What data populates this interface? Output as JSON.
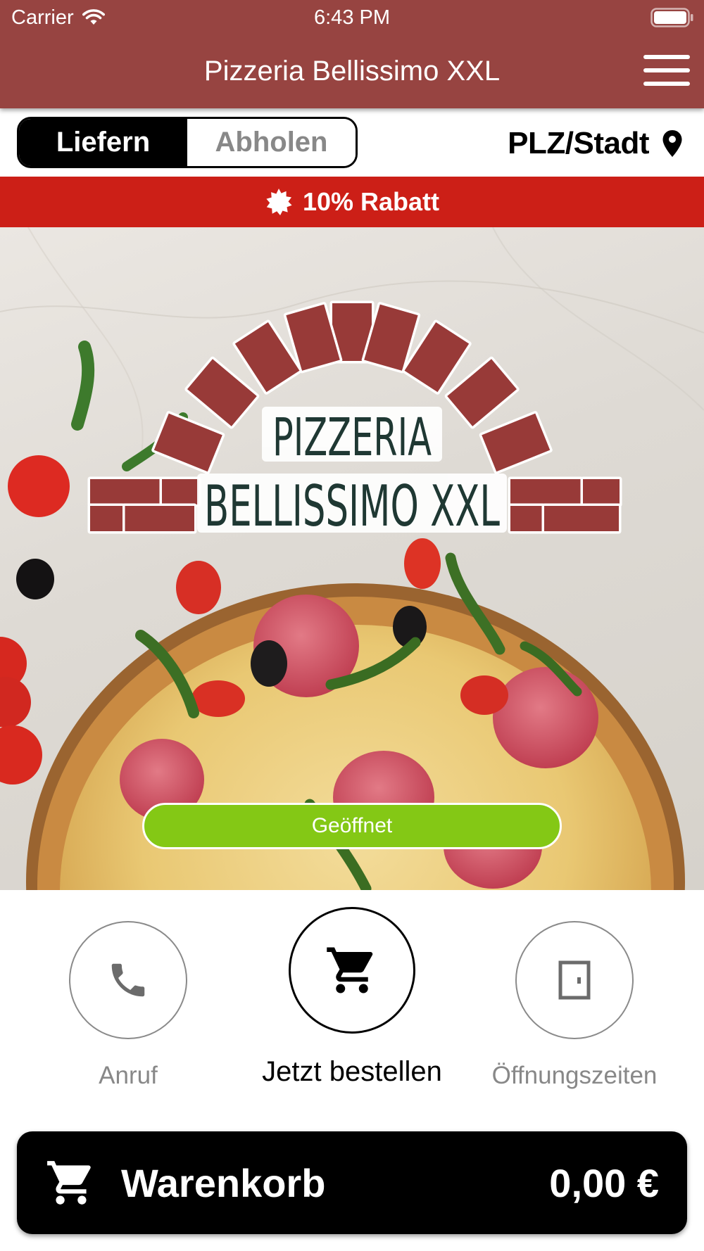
{
  "status_bar": {
    "carrier": "Carrier",
    "time": "6:43 PM"
  },
  "header": {
    "title": "Pizzeria Bellissimo XXL",
    "menu_icon": "hamburger-menu-icon"
  },
  "mode_toggle": {
    "options": [
      "Liefern",
      "Abholen"
    ],
    "selected": "Liefern"
  },
  "location": {
    "label": "PLZ/Stadt",
    "icon": "map-pin-icon"
  },
  "discount": {
    "label": "10% Rabatt",
    "icon": "badge-icon"
  },
  "hero": {
    "logo_lines": [
      "PIZZERIA",
      "BELLISSIMO XXL"
    ],
    "status_label": "Geöffnet"
  },
  "actions": [
    {
      "label": "Anruf",
      "icon": "phone-icon"
    },
    {
      "label": "Jetzt bestellen",
      "icon": "cart-icon"
    },
    {
      "label": "Öffnungszeiten",
      "icon": "door-icon"
    }
  ],
  "cart": {
    "label": "Warenkorb",
    "total": "0,00 €",
    "icon": "cart-icon"
  },
  "colors": {
    "header": "#974441",
    "discount_banner": "#cc1f17",
    "open_badge": "#84c815",
    "logo_brick": "#983a38",
    "logo_text": "#1f3833"
  }
}
